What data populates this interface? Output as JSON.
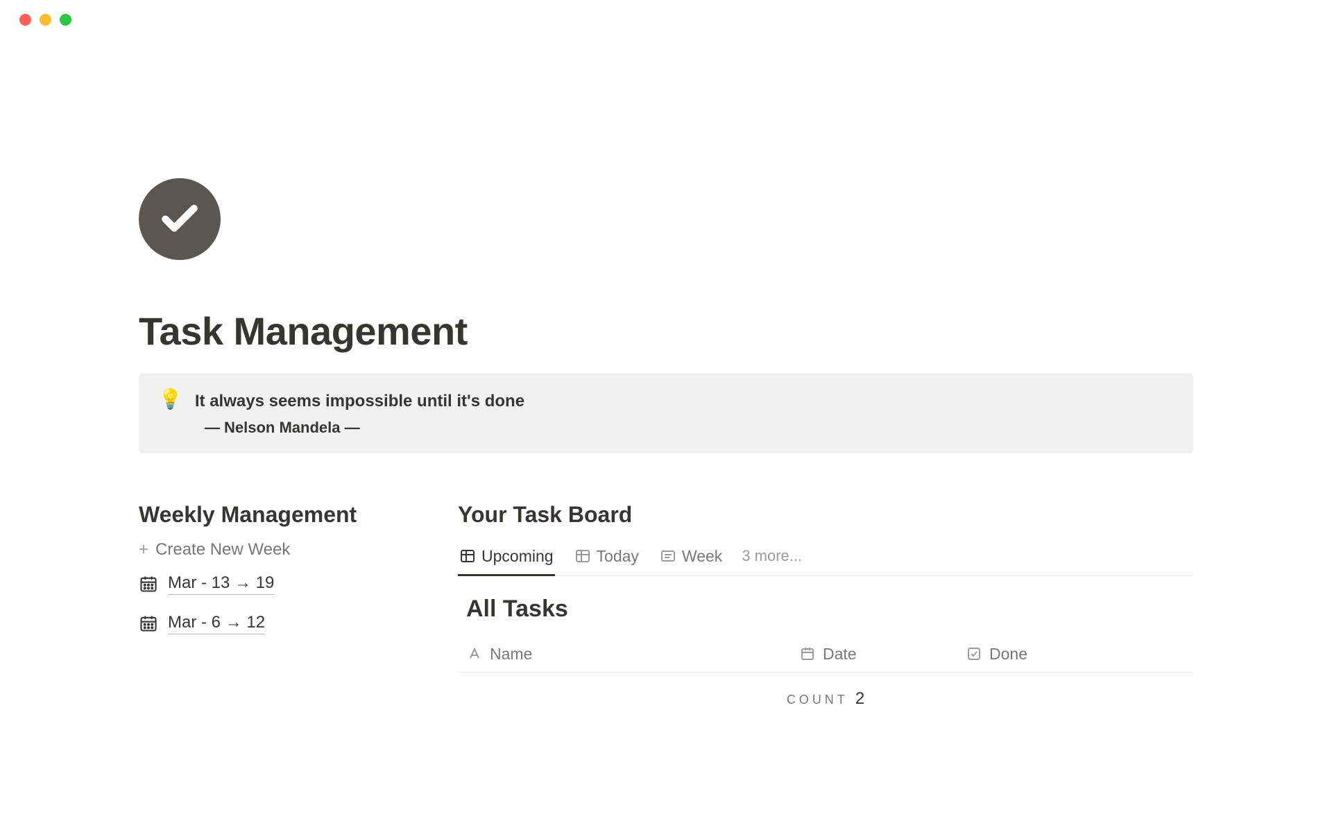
{
  "page": {
    "title": "Task Management"
  },
  "callout": {
    "icon": "💡",
    "quote": "It always seems impossible until it's done",
    "attribution": "— Nelson Mandela —"
  },
  "weekly": {
    "heading": "Weekly Management",
    "create_label": "Create New Week",
    "items": [
      {
        "label": "Mar - 13 → 19"
      },
      {
        "label": "Mar - 6 → 12"
      }
    ]
  },
  "board": {
    "heading": "Your Task Board",
    "tabs": [
      {
        "label": "Upcoming",
        "icon": "table",
        "active": true
      },
      {
        "label": "Today",
        "icon": "table",
        "active": false
      },
      {
        "label": "Week",
        "icon": "list",
        "active": false
      }
    ],
    "more_label": "3 more...",
    "subsection": "All Tasks",
    "columns": [
      {
        "label": "Name",
        "icon": "text"
      },
      {
        "label": "Date",
        "icon": "calendar"
      },
      {
        "label": "Done",
        "icon": "checkbox"
      }
    ],
    "count_label": "COUNT",
    "count_value": "2"
  }
}
